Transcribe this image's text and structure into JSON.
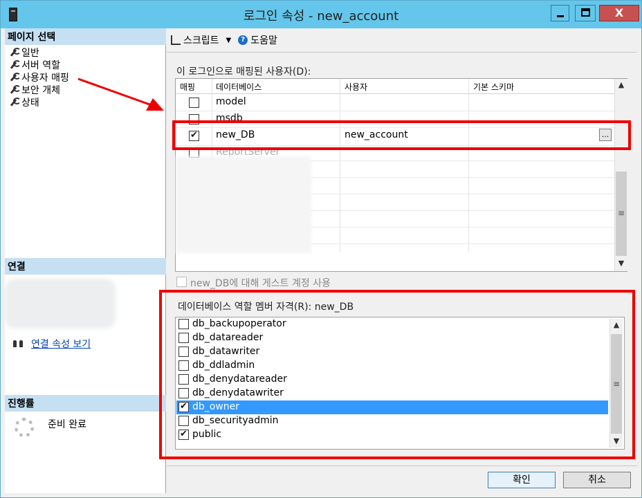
{
  "window": {
    "title": "로그인 속성 - new_account",
    "controls": {
      "minimize": "minimize",
      "maximize": "maximize",
      "close": "X"
    }
  },
  "leftpane": {
    "page_select_header": "페이지 선택",
    "nav_items": [
      "일반",
      "서버 역할",
      "사용자 매핑",
      "보안 개체",
      "상태"
    ],
    "connection_header": "연결",
    "connection_link": "연결 속성 보기",
    "progress_header": "진행률",
    "progress_status": "준비 완료"
  },
  "toolbar": {
    "script_label": "스크립트",
    "help_label": "도움말"
  },
  "mapping": {
    "label": "이 로그인으로 매핑된 사용자(D):",
    "columns": [
      "매핑",
      "데이터베이스",
      "사용자",
      "기본 스키마"
    ],
    "rows": [
      {
        "mapped": false,
        "database": "model",
        "user": "",
        "schema": ""
      },
      {
        "mapped": false,
        "database": "msdb",
        "user": "",
        "schema": ""
      },
      {
        "mapped": true,
        "database": "new_DB",
        "user": "new_account",
        "schema": ""
      },
      {
        "mapped": false,
        "database": "ReportServer",
        "user": "",
        "schema": ""
      }
    ],
    "ellipsis": "..."
  },
  "guest": {
    "label": "new_DB에 대해 게스트 계정 사용",
    "checked": false
  },
  "roles": {
    "label": "데이터베이스 역할 멤버 자격(R): new_DB",
    "items": [
      {
        "name": "db_backupoperator",
        "checked": false
      },
      {
        "name": "db_datareader",
        "checked": false
      },
      {
        "name": "db_datawriter",
        "checked": false
      },
      {
        "name": "db_ddladmin",
        "checked": false
      },
      {
        "name": "db_denydatareader",
        "checked": false
      },
      {
        "name": "db_denydatawriter",
        "checked": false
      },
      {
        "name": "db_owner",
        "checked": true,
        "selected": true
      },
      {
        "name": "db_securityadmin",
        "checked": false
      },
      {
        "name": "public",
        "checked": true
      }
    ]
  },
  "buttons": {
    "ok": "확인",
    "cancel": "취소"
  },
  "colors": {
    "annotation_red": "#e00000",
    "selection_blue": "#3399ff",
    "titlebar": "#64c6ea"
  }
}
